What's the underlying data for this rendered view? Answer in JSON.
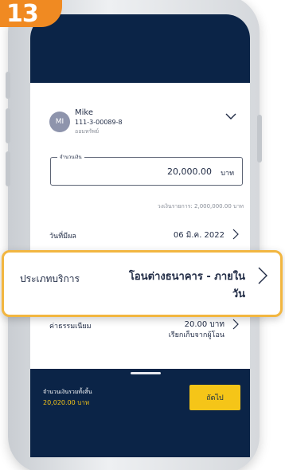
{
  "step": {
    "number": "13"
  },
  "account": {
    "initials": "MI",
    "name": "Mike",
    "number": "111-3-00089-8",
    "type": "ออมทรัพย์"
  },
  "amount": {
    "label": "จำนวนเงิน",
    "value": "20,000.00",
    "unit": "บาท",
    "limit_text": "วงเงินรายการ: 2,000,000.00 บาท"
  },
  "effective_date": {
    "label": "วันที่มีผล",
    "value": "06 มิ.ค. 2022"
  },
  "service_type": {
    "label": "ประเภทบริการ",
    "value": "โอนต่างธนาคาร - ภายในวัน"
  },
  "fee": {
    "label": "ค่าธรรมเนียม",
    "value": "20.00 บาท",
    "note": "เรียกเก็บจากผู้โอน"
  },
  "footer": {
    "total_label": "จำนวนเงินรวมทั้งสิ้น",
    "total_value": "20,020.00 บาท",
    "next_label": "ถัดไป"
  },
  "colors": {
    "navy": "#0b2447",
    "yellow": "#f5c518",
    "badge_orange": "#f08a22",
    "highlight": "#f2b640"
  }
}
